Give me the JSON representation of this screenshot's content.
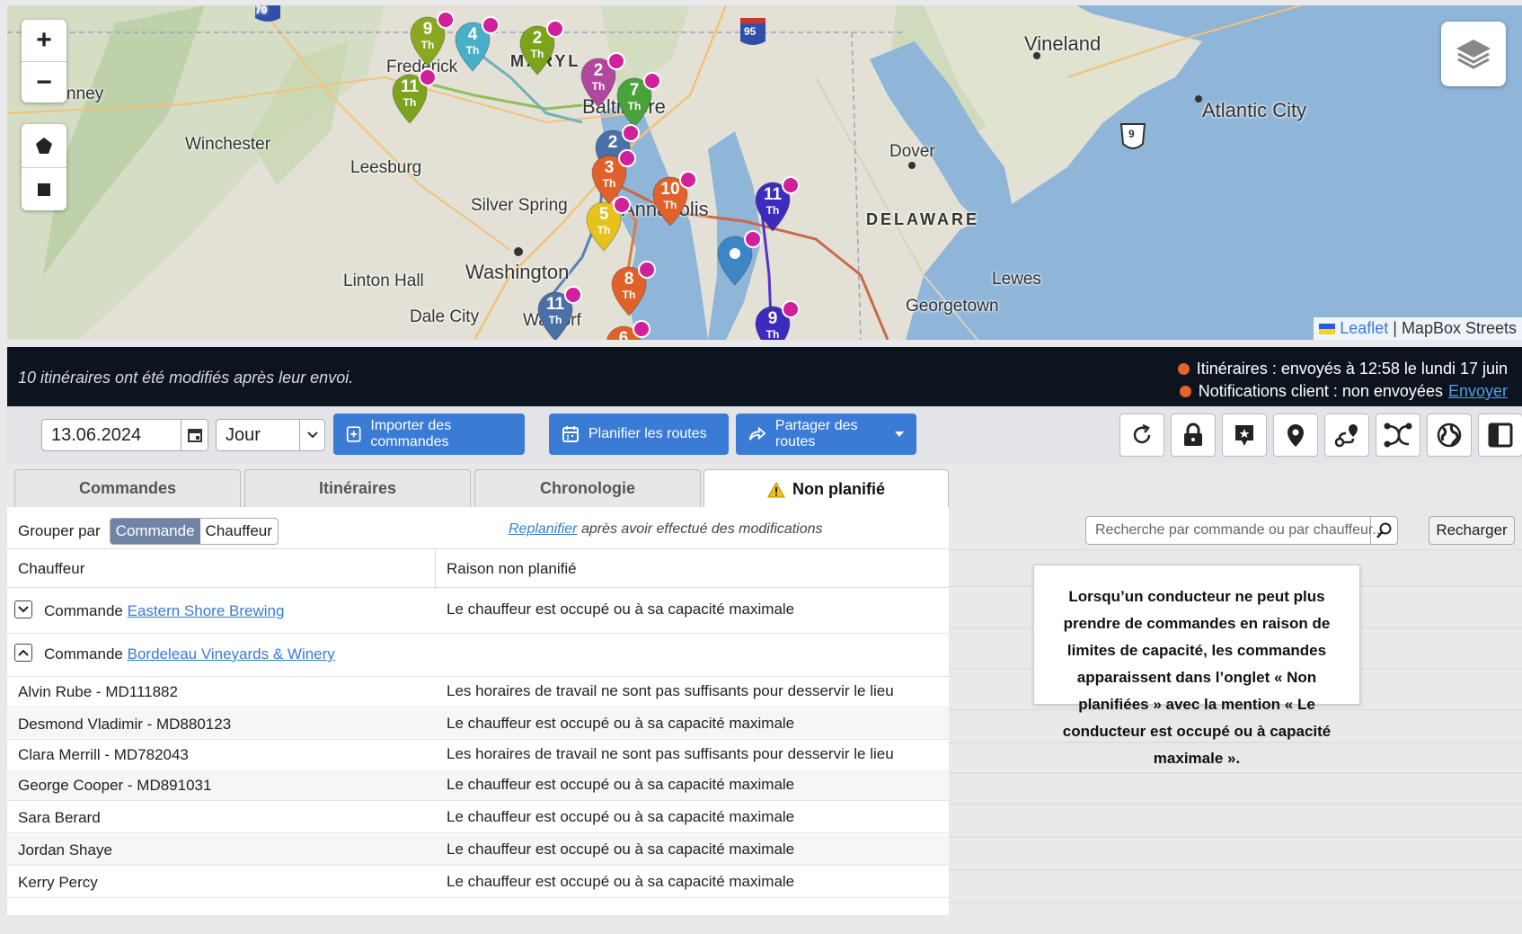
{
  "map": {
    "zoom_in": "+",
    "zoom_out": "−",
    "attribution_link": "Leaflet",
    "attribution_rest": "| MapBox Streets",
    "places": {
      "vineland": "Vineland",
      "atlantic_city": "Atlantic City",
      "frederick": "Frederick",
      "maryland": "MARYL",
      "baltimore": "Baltimore",
      "winchester": "Winchester",
      "leesburg": "Leesburg",
      "silver_spring": "Silver Spring",
      "annapolis": "Annapolis",
      "dover": "Dover",
      "delaware": "DELAWARE",
      "washington": "Washington",
      "linton_hall": "Linton Hall",
      "dale_city": "Dale City",
      "waldorf": "Waldorf",
      "lewes": "Lewes",
      "georgetown": "Georgetown",
      "cumberland_partial": "nney"
    },
    "road_shields": {
      "i70": "70",
      "i95": "95",
      "us9": "9"
    },
    "markers": [
      {
        "num": "9",
        "sub": "Th",
        "color": "#8aa81f"
      },
      {
        "num": "4",
        "sub": "Th",
        "color": "#49aec7"
      },
      {
        "num": "2",
        "sub": "Th",
        "color": "#7ba31c"
      },
      {
        "num": "11",
        "sub": "Th",
        "color": "#7ba31c"
      },
      {
        "num": "2",
        "sub": "Th",
        "color": "#b2479e"
      },
      {
        "num": "7",
        "sub": "Th",
        "color": "#4aa23a"
      },
      {
        "num": "2",
        "sub": "",
        "color": "#4b6fa8"
      },
      {
        "num": "3",
        "sub": "Th",
        "color": "#e0622a"
      },
      {
        "num": "10",
        "sub": "Th",
        "color": "#e0622a"
      },
      {
        "num": "5",
        "sub": "Th",
        "color": "#e6c21f"
      },
      {
        "num": "11",
        "sub": "Th",
        "color": "#3c2bbf"
      },
      {
        "num": "8",
        "sub": "Th",
        "color": "#e0622a"
      },
      {
        "num": "11",
        "sub": "Th",
        "color": "#4b6fa8"
      },
      {
        "num": "9",
        "sub": "Th",
        "color": "#3c2bbf"
      },
      {
        "num": "6",
        "sub": "",
        "color": "#e0622a"
      },
      {
        "num": "",
        "sub": "",
        "color": "#3d86c6"
      }
    ]
  },
  "status": {
    "message": "10 itinéraires ont été modifiés après leur envoi.",
    "routes_status": "Itinéraires : envoyés à 12:58 le lundi 17 juin",
    "notif_status": "Notifications client : non envoyées",
    "send_link": "Envoyer"
  },
  "toolbar": {
    "date": "13.06.2024",
    "period": "Jour",
    "import_btn": "Importer des commandes",
    "plan_btn": "Planifier les routes",
    "share_btn": "Partager des routes"
  },
  "tabs": [
    "Commandes",
    "Itinéraires",
    "Chronologie",
    "Non planifié"
  ],
  "panel": {
    "group_label": "Grouper par",
    "group_options": [
      "Commande",
      "Chauffeur"
    ],
    "replan_link": "Replanifier",
    "replan_rest": "après avoir effectué des modifications",
    "col_driver": "Chauffeur",
    "col_reason": "Raison non planifié",
    "order_prefix": "Commande",
    "order1_name": "Eastern Shore Brewing",
    "order1_reason": "Le chauffeur est occupé ou à sa capacité maximale",
    "order2_name": "Bordeleau Vineyards & Winery",
    "rows": [
      {
        "driver": "Alvin Rube - MD111882",
        "reason": "Les horaires de travail ne sont pas suffisants pour desservir le lieu"
      },
      {
        "driver": "Desmond Vladimir - MD880123",
        "reason": "Le chauffeur est occupé ou à sa capacité maximale"
      },
      {
        "driver": "Clara Merrill - MD782043",
        "reason": "Les horaires de travail ne sont pas suffisants pour desservir le lieu"
      },
      {
        "driver": "George Cooper - MD891031",
        "reason": "Le chauffeur est occupé ou à sa capacité maximale"
      },
      {
        "driver": "Sara Berard",
        "reason": "Le chauffeur est occupé ou à sa capacité maximale"
      },
      {
        "driver": "Jordan Shaye",
        "reason": "Le chauffeur est occupé ou à sa capacité maximale"
      },
      {
        "driver": "Kerry Percy",
        "reason": "Le chauffeur est occupé ou à sa capacité maximale"
      }
    ]
  },
  "search": {
    "placeholder": "Recherche par commande ou par chauffeur...",
    "reload": "Recharger"
  },
  "note": "Lorsqu’un conducteur ne peut plus prendre de commandes en raison de limites de capacité, les commandes apparaissent dans l’onglet « Non planifiées » avec la mention « Le conducteur est occupé ou à capacité maximale »."
}
